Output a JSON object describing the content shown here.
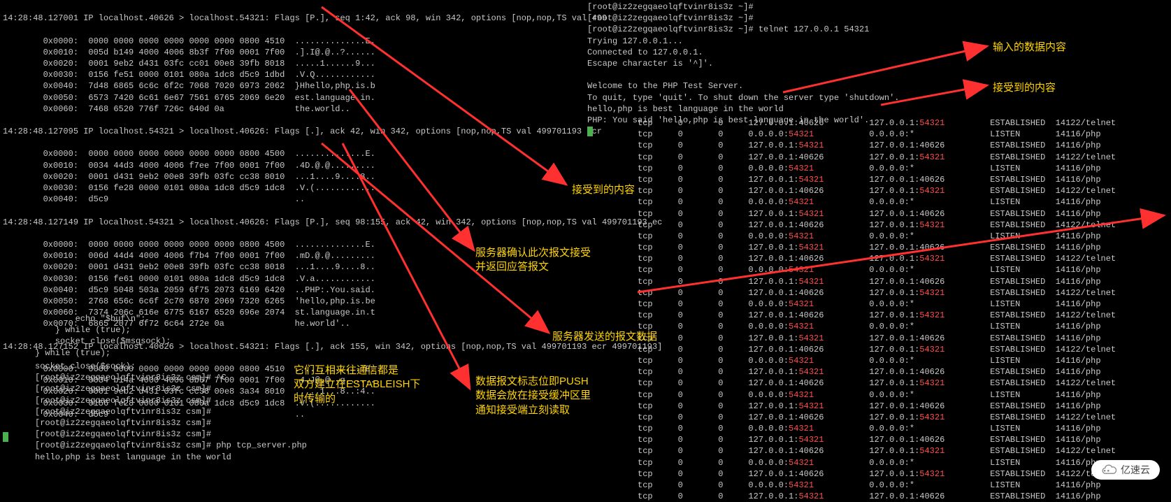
{
  "tcpdump": {
    "pkt1": {
      "header": "14:28:48.127001 IP localhost.40626 > localhost.54321: Flags [P.], seq 1:42, ack 98, win 342, options [nop,nop,TS val 499",
      "lines": [
        "        0x0000:  0000 0000 0000 0000 0000 0000 0800 4510  ..............E.",
        "        0x0010:  005d b149 4000 4006 8b3f 7f00 0001 7f00  .].I@.@..?......",
        "        0x0020:  0001 9eb2 d431 03fc cc01 00e8 39fb 8018  .....1......9...",
        "        0x0030:  0156 fe51 0000 0101 080a 1dc8 d5c9 1dbd  .V.Q............",
        "        0x0040:  7d48 6865 6c6c 6f2c 7068 7020 6973 2062  }Hhello,php.is.b",
        "        0x0050:  6573 7420 6c61 6e67 7561 6765 2069 6e20  est.language.in.",
        "        0x0060:  7468 6520 776f 726c 640d 0a              the.world.."
      ]
    },
    "pkt2": {
      "header": "14:28:48.127095 IP localhost.54321 > localhost.40626: Flags [.], ack 42, win 342, options [nop,nop,TS val 499701193 ecr",
      "lines": [
        "        0x0000:  0000 0000 0000 0000 0000 0000 0800 4500  ..............E.",
        "        0x0010:  0034 44d3 4000 4006 f7ee 7f00 0001 7f00  .4D.@.@.........",
        "        0x0020:  0001 d431 9eb2 00e8 39fb 03fc cc38 8010  ...1....9....8..",
        "        0x0030:  0156 fe28 0000 0101 080a 1dc8 d5c9 1dc8  .V.(............",
        "        0x0040:  d5c9                                     .."
      ]
    },
    "pkt3": {
      "header": "14:28:48.127149 IP localhost.54321 > localhost.40626: Flags [P.], seq 98:155, ack 42, win 342, options [nop,nop,TS val 499701193 ec",
      "lines": [
        "        0x0000:  0000 0000 0000 0000 0000 0000 0800 4500  ..............E.",
        "        0x0010:  006d 44d4 4000 4006 f7b4 7f00 0001 7f00  .mD.@.@.........",
        "        0x0020:  0001 d431 9eb2 00e8 39fb 03fc cc38 8018  ...1....9....8..",
        "        0x0030:  0156 fe61 0000 0101 080a 1dc8 d5c9 1dc8  .V.a............",
        "        0x0040:  d5c9 5048 503a 2059 6f75 2073 6169 6420  ..PHP:.You.said.",
        "        0x0050:  2768 656c 6c6f 2c70 6870 2069 7320 6265  'hello,php.is.be",
        "        0x0060:  7374 206c 616e 6775 6167 6520 696e 2074  st.language.in.t",
        "        0x0070:  6865 2077 6f72 6c64 272e 0a              he.world'.."
      ]
    },
    "pkt4": {
      "header": "14:28:48.127152 IP localhost.40626 > localhost.54321: Flags [.], ack 155, win 342, options [nop,nop,TS val 499701193 ecr 499701193]",
      "lines": [
        "        0x0000:  0000 0000 0000 0000 0000 0000 0800 4510  ..............E.",
        "        0x0010:  0034 b14a 4000 4006 8b67 7f00 0001 7f00  .4.J@.@..g......",
        "        0x0020:  0001 9eb2 d431 03fc cc38 00e8 3a34 8010  .....1...8..:4..",
        "        0x0030:  0156 fe28 0000 0101 080a 1dc8 d5c9 1dc8  .V.(............",
        "        0x0040:  d5c9                                     .."
      ]
    }
  },
  "code": [
    "        echo \"$buf\\n\";",
    "    } while (true);",
    "    socket_close($msgsock);",
    "} while (true);"
  ],
  "shell": {
    "prompt": "[root@iz2zegqaeolqftvinr8is3z csm]#",
    "lines": [
      "socket_close($sock);",
      "[root@iz2zegqaeolqftvinr8is3z csm]# ^C",
      "[root@iz2zegqaeolqftvinr8is3z csm]#",
      "[root@iz2zegqaeolqftvinr8is3z csm]#",
      "[root@iz2zegqaeolqftvinr8is3z csm]#",
      "[root@iz2zegqaeolqftvinr8is3z csm]#",
      "[root@iz2zegqaeolqftvinr8is3z csm]#",
      "[root@iz2zegqaeolqftvinr8is3z csm]# php tcp_server.php",
      "hello,php is best language in the world"
    ]
  },
  "telnet": {
    "lines": [
      "[root@iz2zegqaeolqftvinr8is3z ~]#",
      "[root@iz2zegqaeolqftvinr8is3z ~]#",
      "[root@iz2zegqaeolqftvinr8is3z ~]# telnet 127.0.0.1 54321",
      "Trying 127.0.0.1...",
      "Connected to 127.0.0.1.",
      "Escape character is '^]'.",
      "",
      "Welcome to the PHP Test Server.",
      "To quit, type 'quit'. To shut down the server type 'shutdown'.",
      "hello,php is best language in the world",
      "PHP: You said 'hello,php is best language in the world'."
    ]
  },
  "netstat": {
    "rows": [
      [
        "tcp",
        "0",
        "0",
        "127.0.0.1:40626",
        "127.0.0.1:54321",
        "ESTABLISHED",
        "14122/telnet"
      ],
      [
        "tcp",
        "0",
        "0",
        "0.0.0.0:54321",
        "0.0.0.0:*",
        "LISTEN",
        "14116/php"
      ],
      [
        "tcp",
        "0",
        "0",
        "127.0.0.1:54321",
        "127.0.0.1:40626",
        "ESTABLISHED",
        "14116/php"
      ],
      [
        "tcp",
        "0",
        "0",
        "127.0.0.1:40626",
        "127.0.0.1:54321",
        "ESTABLISHED",
        "14122/telnet"
      ],
      [
        "tcp",
        "0",
        "0",
        "0.0.0.0:54321",
        "0.0.0.0:*",
        "LISTEN",
        "14116/php"
      ],
      [
        "tcp",
        "0",
        "0",
        "127.0.0.1:54321",
        "127.0.0.1:40626",
        "ESTABLISHED",
        "14116/php"
      ],
      [
        "tcp",
        "0",
        "0",
        "127.0.0.1:40626",
        "127.0.0.1:54321",
        "ESTABLISHED",
        "14122/telnet"
      ],
      [
        "tcp",
        "0",
        "0",
        "0.0.0.0:54321",
        "0.0.0.0:*",
        "LISTEN",
        "14116/php"
      ],
      [
        "tcp",
        "0",
        "0",
        "127.0.0.1:54321",
        "127.0.0.1:40626",
        "ESTABLISHED",
        "14116/php"
      ],
      [
        "tcp",
        "0",
        "0",
        "127.0.0.1:40626",
        "127.0.0.1:54321",
        "ESTABLISHED",
        "14122/telnet"
      ],
      [
        "tcp",
        "0",
        "0",
        "0.0.0.0:54321",
        "0.0.0.0:*",
        "LISTEN",
        "14116/php"
      ],
      [
        "tcp",
        "0",
        "0",
        "127.0.0.1:54321",
        "127.0.0.1:40626",
        "ESTABLISHED",
        "14116/php"
      ],
      [
        "tcp",
        "0",
        "0",
        "127.0.0.1:40626",
        "127.0.0.1:54321",
        "ESTABLISHED",
        "14122/telnet"
      ],
      [
        "tcp",
        "0",
        "0",
        "0.0.0.0:54321",
        "0.0.0.0:*",
        "LISTEN",
        "14116/php"
      ],
      [
        "tcp",
        "0",
        "0",
        "127.0.0.1:54321",
        "127.0.0.1:40626",
        "ESTABLISHED",
        "14116/php"
      ],
      [
        "tcp",
        "0",
        "0",
        "127.0.0.1:40626",
        "127.0.0.1:54321",
        "ESTABLISHED",
        "14122/telnet"
      ],
      [
        "tcp",
        "0",
        "0",
        "0.0.0.0:54321",
        "0.0.0.0:*",
        "LISTEN",
        "14116/php"
      ],
      [
        "tcp",
        "0",
        "0",
        "127.0.0.1:40626",
        "127.0.0.1:54321",
        "ESTABLISHED",
        "14122/telnet"
      ],
      [
        "tcp",
        "0",
        "0",
        "0.0.0.0:54321",
        "0.0.0.0:*",
        "LISTEN",
        "14116/php"
      ],
      [
        "tcp",
        "0",
        "0",
        "127.0.0.1:54321",
        "127.0.0.1:40626",
        "ESTABLISHED",
        "14116/php"
      ],
      [
        "tcp",
        "0",
        "0",
        "127.0.0.1:40626",
        "127.0.0.1:54321",
        "ESTABLISHED",
        "14122/telnet"
      ],
      [
        "tcp",
        "0",
        "0",
        "0.0.0.0:54321",
        "0.0.0.0:*",
        "LISTEN",
        "14116/php"
      ],
      [
        "tcp",
        "0",
        "0",
        "127.0.0.1:54321",
        "127.0.0.1:40626",
        "ESTABLISHED",
        "14116/php"
      ],
      [
        "tcp",
        "0",
        "0",
        "127.0.0.1:40626",
        "127.0.0.1:54321",
        "ESTABLISHED",
        "14122/telnet"
      ],
      [
        "tcp",
        "0",
        "0",
        "0.0.0.0:54321",
        "0.0.0.0:*",
        "LISTEN",
        "14116/php"
      ],
      [
        "tcp",
        "0",
        "0",
        "127.0.0.1:54321",
        "127.0.0.1:40626",
        "ESTABLISHED",
        "14116/php"
      ],
      [
        "tcp",
        "0",
        "0",
        "127.0.0.1:40626",
        "127.0.0.1:54321",
        "ESTABLISHED",
        "14122/telnet"
      ],
      [
        "tcp",
        "0",
        "0",
        "0.0.0.0:54321",
        "0.0.0.0:*",
        "LISTEN",
        "14116/php"
      ],
      [
        "tcp",
        "0",
        "0",
        "127.0.0.1:54321",
        "127.0.0.1:40626",
        "ESTABLISHED",
        "14116/php"
      ],
      [
        "tcp",
        "0",
        "0",
        "127.0.0.1:40626",
        "127.0.0.1:54321",
        "ESTABLISHED",
        "14122/telnet"
      ],
      [
        "tcp",
        "0",
        "0",
        "0.0.0.0:54321",
        "0.0.0.0:*",
        "LISTEN",
        "14116/php"
      ],
      [
        "tcp",
        "0",
        "0",
        "127.0.0.1:40626",
        "127.0.0.1:54321",
        "ESTABLISHED",
        "14122/telnet"
      ],
      [
        "tcp",
        "0",
        "0",
        "0.0.0.0:54321",
        "0.0.0.0:*",
        "LISTEN",
        "14116/php"
      ],
      [
        "tcp",
        "0",
        "0",
        "127.0.0.1:54321",
        "127.0.0.1:40626",
        "ESTABLISHED",
        "14116/php"
      ]
    ]
  },
  "annotations": {
    "a1": "输入的数据内容",
    "a2": "接受到的内容",
    "a3": "接受到的内容",
    "a4": "服务器确认此次报文接受\n并返回应答报文",
    "a5": "服务器发送的报文数据",
    "a6": "数据报文标志位即PUSH\n数据会放在接受缓冲区里\n通知接受端立刻读取",
    "a7": "它们互相来往通信都是\n双方建立在ESTABLEISH下\n时传输的"
  },
  "logo": "亿速云"
}
